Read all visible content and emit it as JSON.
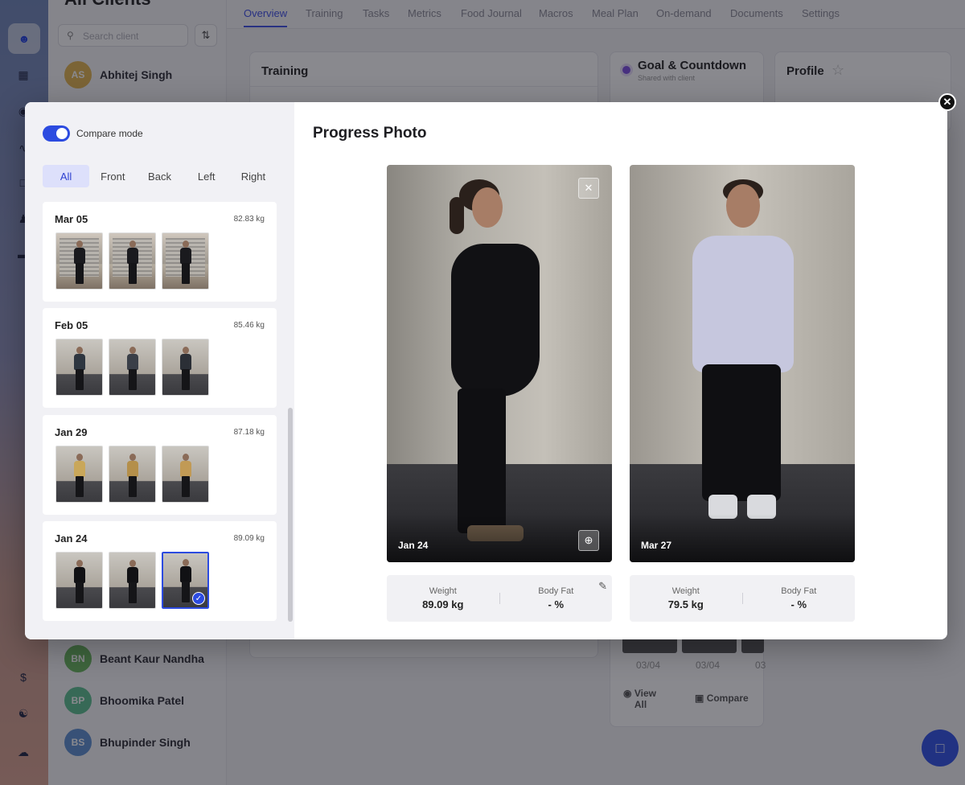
{
  "app": {
    "client_list_title": "All Clients",
    "search_placeholder": "Search client",
    "clients_top": [
      {
        "initials": "AS",
        "name": "Abhitej Singh",
        "color": "#e2b54e"
      }
    ],
    "clients_bottom": [
      {
        "initials": "BN",
        "name": "Beant Kaur Nandha",
        "color": "#69b65c"
      },
      {
        "initials": "BP",
        "name": "Bhoomika Patel",
        "color": "#5bbf8e"
      },
      {
        "initials": "BS",
        "name": "Bhupinder Singh",
        "color": "#5d8fd0"
      }
    ],
    "tabs": [
      "Overview",
      "Training",
      "Tasks",
      "Metrics",
      "Food Journal",
      "Macros",
      "Meal Plan",
      "On-demand",
      "Documents",
      "Settings"
    ],
    "cards": {
      "training": "Training",
      "goal": "Goal & Countdown",
      "goal_sub": "Shared with client",
      "profile": "Profile"
    },
    "bg_photo_dates": [
      "03/04",
      "03/04",
      "03"
    ],
    "view_all": "View All",
    "compare": "Compare"
  },
  "modal": {
    "compare_mode_label": "Compare mode",
    "compare_mode_on": true,
    "filters": [
      "All",
      "Front",
      "Back",
      "Left",
      "Right"
    ],
    "active_filter": "All",
    "title": "Progress Photo",
    "entries": [
      {
        "date": "Mar 05",
        "weight": "82.83 kg",
        "photos": 3
      },
      {
        "date": "Feb 05",
        "weight": "85.46 kg",
        "photos": 3
      },
      {
        "date": "Jan 29",
        "weight": "87.18 kg",
        "photos": 3
      },
      {
        "date": "Jan 24",
        "weight": "89.09 kg",
        "photos": 3,
        "selected_photo": 3
      }
    ],
    "compare": [
      {
        "date": "Jan 24",
        "weight_label": "Weight",
        "weight": "89.09 kg",
        "bodyfat_label": "Body Fat",
        "bodyfat": "- %"
      },
      {
        "date": "Mar 27",
        "weight_label": "Weight",
        "weight": "79.5 kg",
        "bodyfat_label": "Body Fat",
        "bodyfat": "- %"
      }
    ]
  }
}
